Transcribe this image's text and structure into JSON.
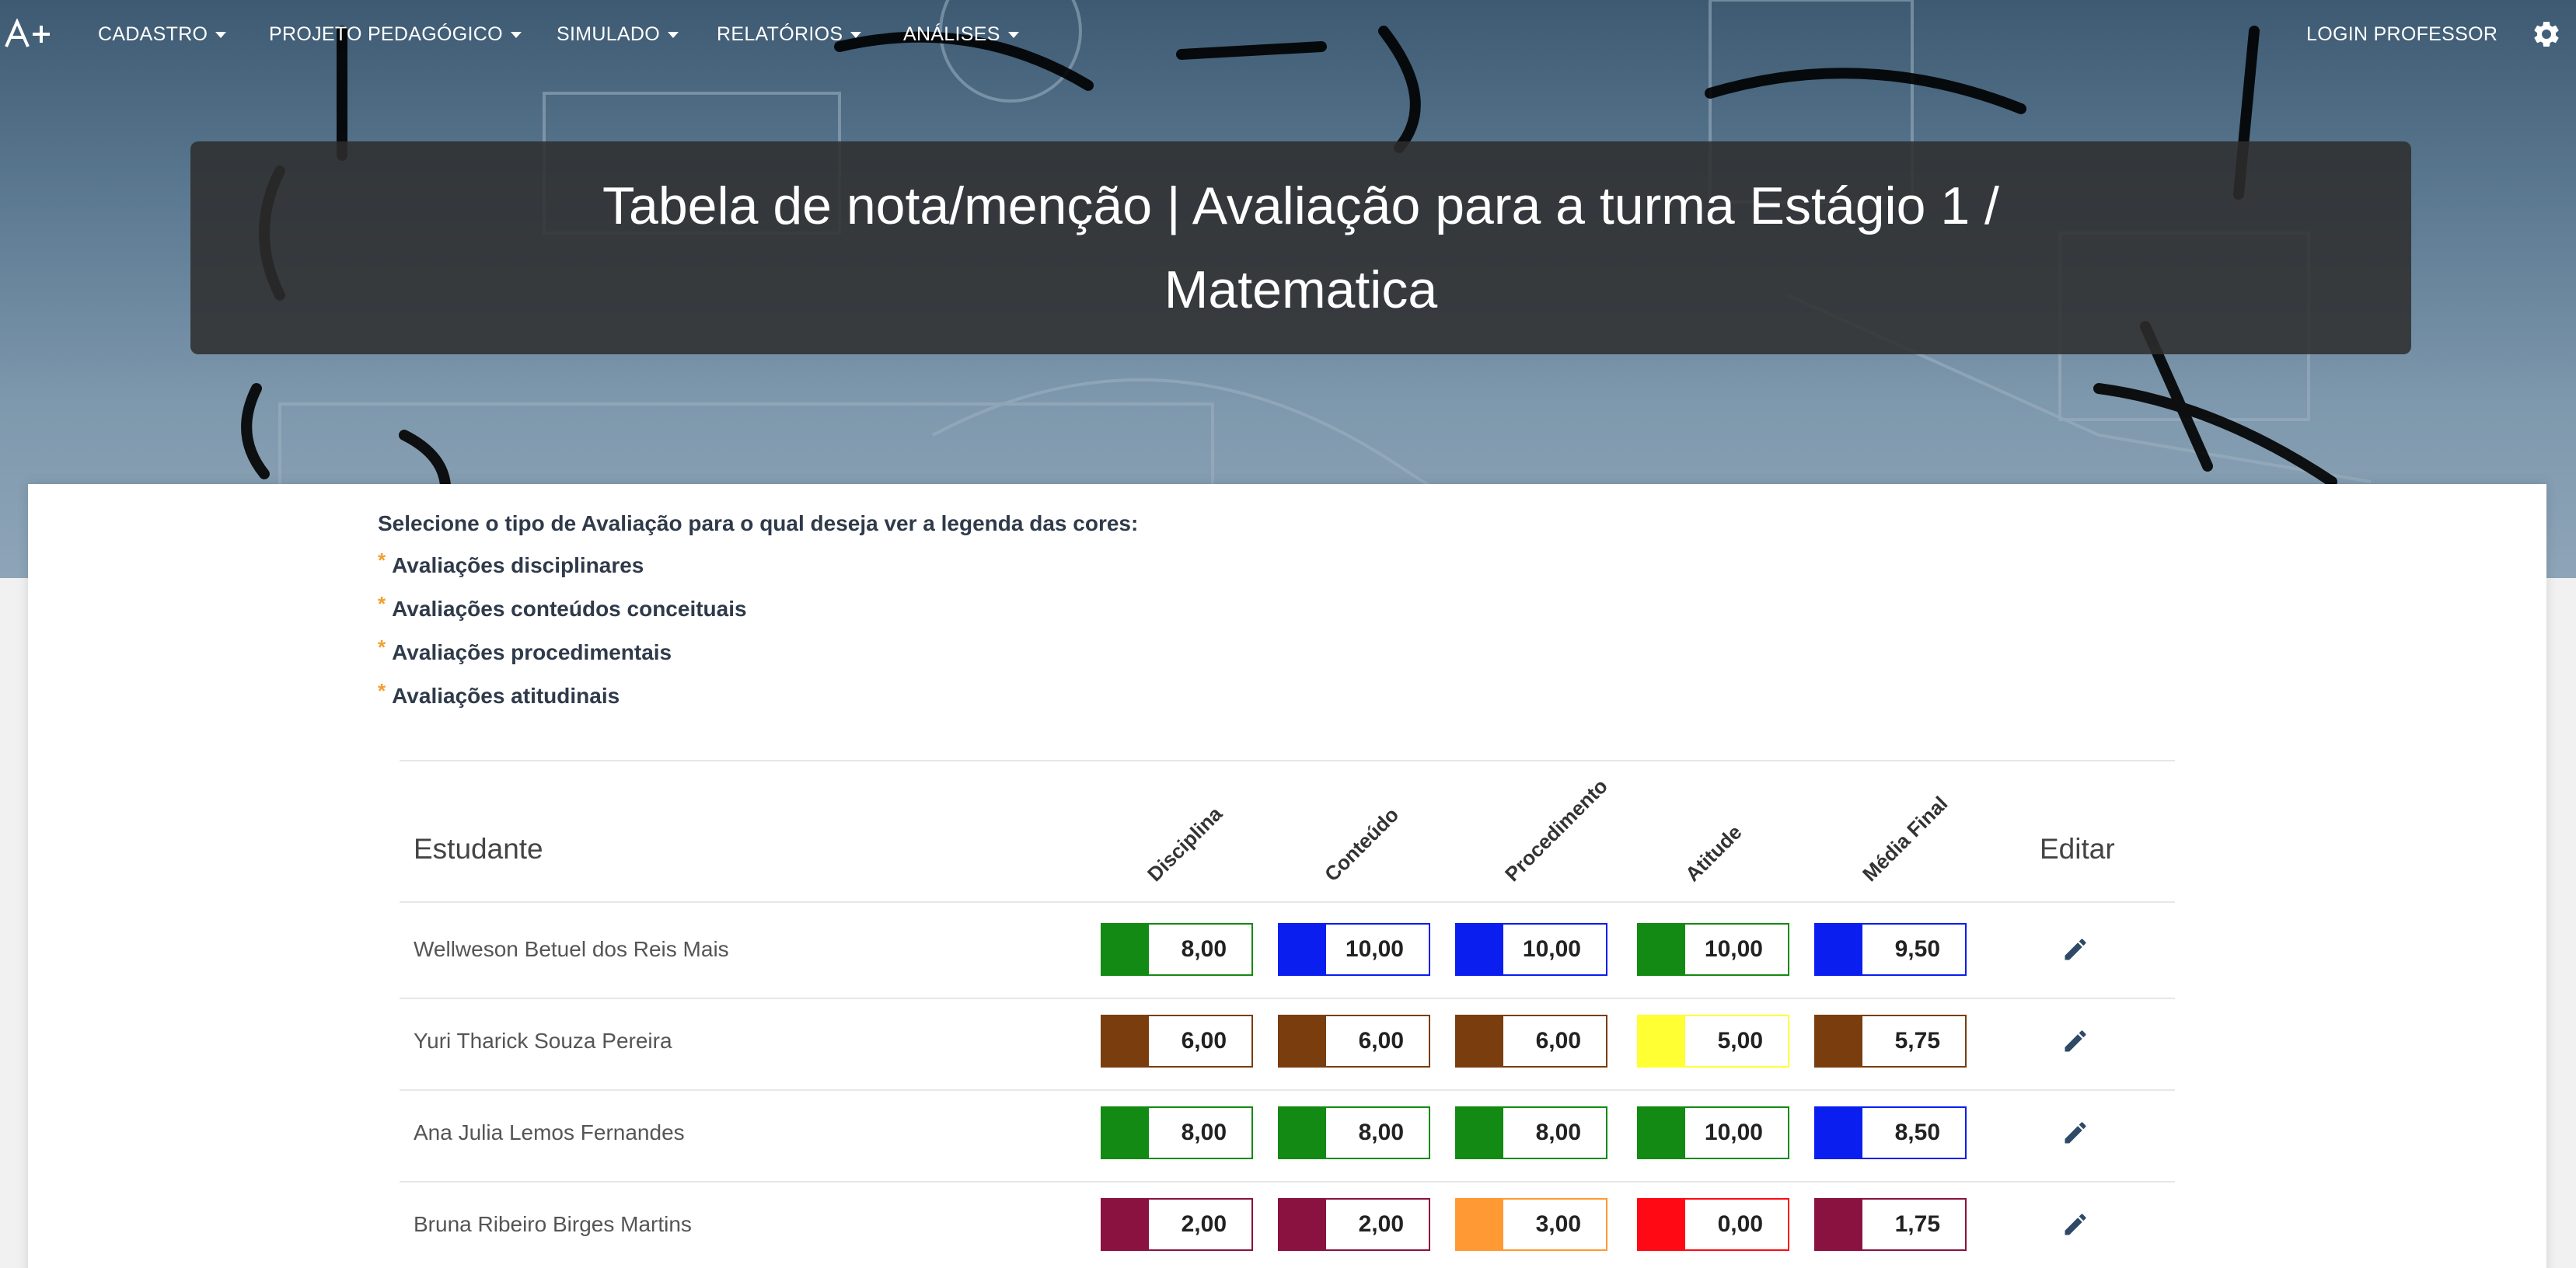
{
  "navbar": {
    "brand": "A+",
    "menus": [
      {
        "label": "CADASTRO"
      },
      {
        "label": "PROJETO PEDAGÓGICO"
      },
      {
        "label": "SIMULADO"
      },
      {
        "label": "RELATÓRIOS"
      },
      {
        "label": "ANÁLISES"
      }
    ],
    "login": "LOGIN PROFESSOR",
    "settings_icon": "gear-icon"
  },
  "title": "Tabela de nota/menção | Avaliação para a turma Estágio 1 / Matematica",
  "legend": {
    "prompt": "Selecione o tipo de Avaliação para o qual deseja ver a legenda das cores:",
    "items": [
      "Avaliações disciplinares",
      "Avaliações conteúdos conceituais",
      "Avaliações procedimentais",
      "Avaliações atitudinais"
    ],
    "bullet": "*"
  },
  "table": {
    "headers": {
      "student": "Estudante",
      "disciplina": "Disciplina",
      "conteudo": "Conteúdo",
      "procedimento": "Procedimento",
      "atitude": "Atitude",
      "media": "Média Final",
      "edit": "Editar"
    },
    "rows": [
      {
        "name": "Wellweson Betuel dos Reis Mais",
        "scores": [
          {
            "value": "8,00",
            "color": "#138a13"
          },
          {
            "value": "10,00",
            "color": "#0a1eef"
          },
          {
            "value": "10,00",
            "color": "#0a1eef"
          },
          {
            "value": "10,00",
            "color": "#138a13"
          },
          {
            "value": "9,50",
            "color": "#0a1eef"
          }
        ]
      },
      {
        "name": "Yuri Tharick Souza Pereira",
        "scores": [
          {
            "value": "6,00",
            "color": "#7a3d0e"
          },
          {
            "value": "6,00",
            "color": "#7a3d0e"
          },
          {
            "value": "6,00",
            "color": "#7a3d0e"
          },
          {
            "value": "5,00",
            "color": "#ffff33"
          },
          {
            "value": "5,75",
            "color": "#7a3d0e"
          }
        ]
      },
      {
        "name": "Ana Julia Lemos Fernandes",
        "scores": [
          {
            "value": "8,00",
            "color": "#138a13"
          },
          {
            "value": "8,00",
            "color": "#138a13"
          },
          {
            "value": "8,00",
            "color": "#138a13"
          },
          {
            "value": "10,00",
            "color": "#138a13"
          },
          {
            "value": "8,50",
            "color": "#0a1eef"
          }
        ]
      },
      {
        "name": "Bruna Ribeiro Birges Martins",
        "scores": [
          {
            "value": "2,00",
            "color": "#8a1240"
          },
          {
            "value": "2,00",
            "color": "#8a1240"
          },
          {
            "value": "3,00",
            "color": "#ff9933"
          },
          {
            "value": "0,00",
            "color": "#ff0a14"
          },
          {
            "value": "1,75",
            "color": "#8a1240"
          }
        ]
      }
    ],
    "edit_icon": "pencil-icon"
  }
}
